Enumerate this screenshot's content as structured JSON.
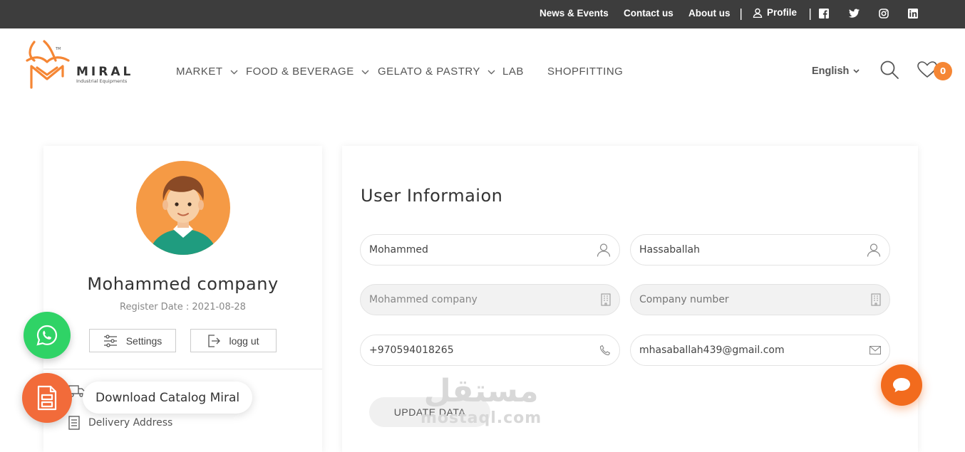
{
  "topbar": {
    "news_events": "News & Events",
    "contact_us": "Contact us",
    "about_us": "About us",
    "separator": "|",
    "profile": "Profile",
    "social": [
      "facebook-icon",
      "twitter-icon",
      "instagram-icon",
      "linkedin-icon"
    ]
  },
  "brand": {
    "name": "MIRAL",
    "tagline": "Industrial Equipments",
    "tm": "TM",
    "color": "#f58634"
  },
  "nav": {
    "items": [
      {
        "label": "MARKET",
        "dropdown": true
      },
      {
        "label": "FOOD & BEVERAGE",
        "dropdown": true
      },
      {
        "label": "GELATO & PASTRY",
        "dropdown": true
      },
      {
        "label": "LAB",
        "dropdown": false
      },
      {
        "label": "SHOPFITTING",
        "dropdown": false
      }
    ],
    "language": "English",
    "wishlist_count": "0"
  },
  "profile": {
    "company_name": "Mohammed company",
    "register_date": "Register Date : 2021-08-28",
    "settings_label": "Settings",
    "logout_label": "logg ut",
    "menu": [
      {
        "label": "",
        "icon": "truck-icon"
      },
      {
        "label": "Delivery Address",
        "icon": "document-icon"
      }
    ]
  },
  "user_info": {
    "title": "User Informaion",
    "first_name": "Mohammed",
    "last_name": "Hassaballah",
    "company": "Mohammed company",
    "company_number_placeholder": "Company number",
    "phone": "+970594018265",
    "email": "mhasaballah439@gmail.com",
    "update_label": "UPDATE DATA"
  },
  "floating": {
    "catalog_label": "Download Catalog Miral"
  },
  "watermark": {
    "arabic": "مستقل",
    "latin": "mostaql.com"
  },
  "colors": {
    "accent": "#f58634",
    "whatsapp": "#2fd366",
    "topbar": "#3d3d3d"
  }
}
